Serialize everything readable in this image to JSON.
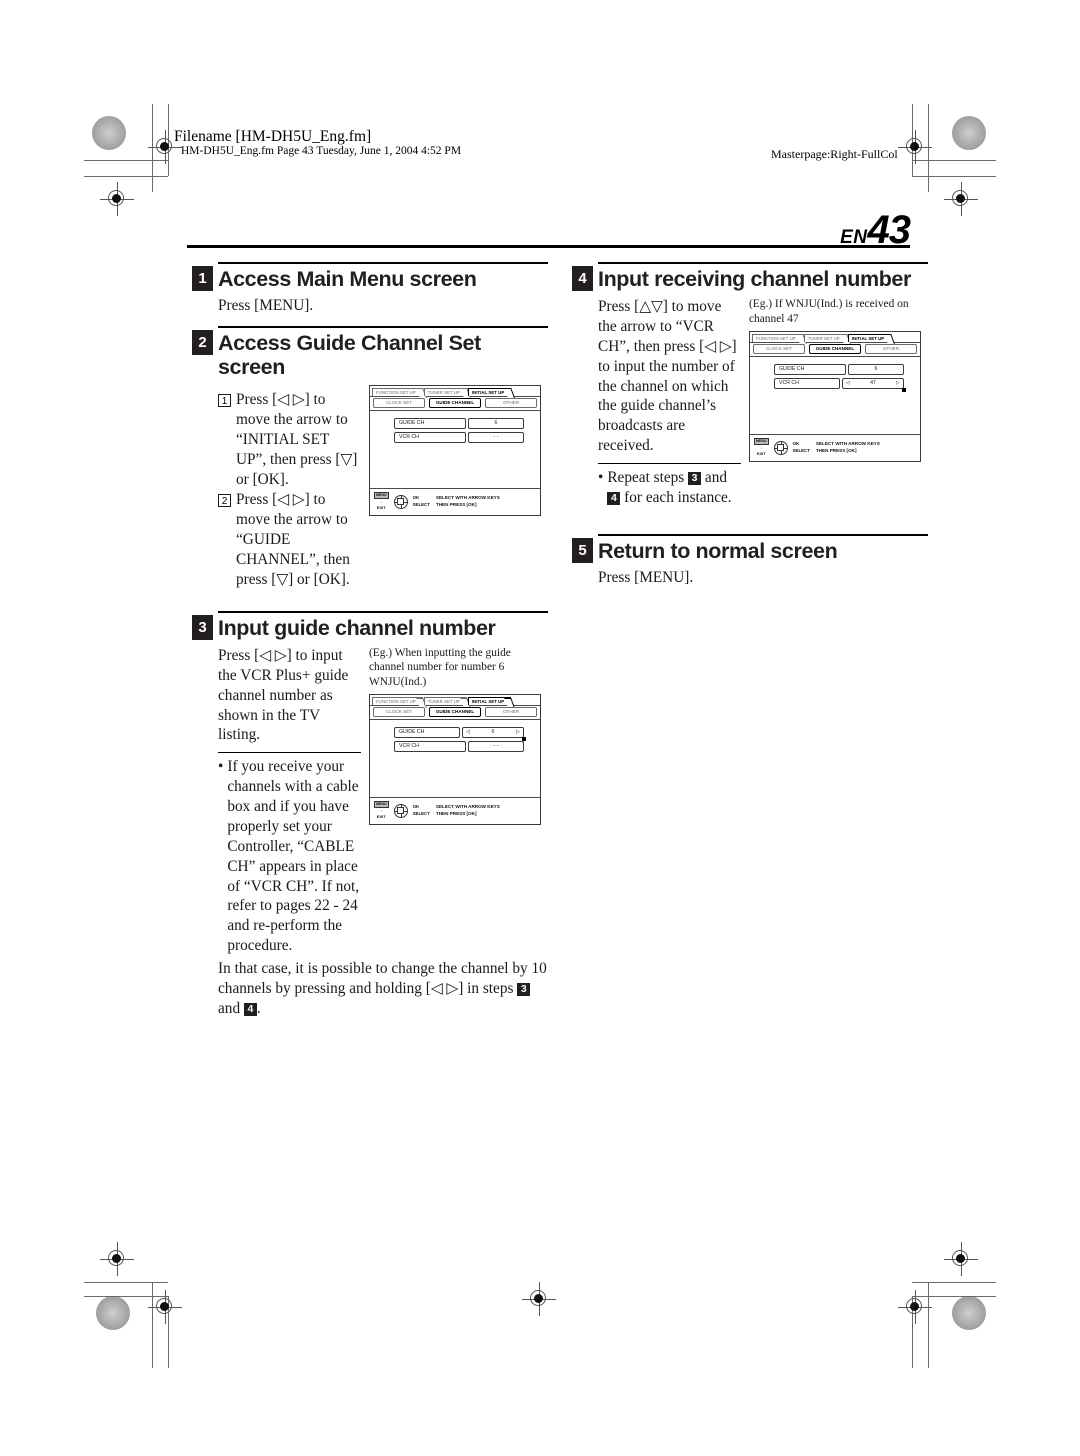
{
  "header": {
    "filename": "Filename [HM-DH5U_Eng.fm]",
    "fileinfo": "HM-DH5U_Eng.fm  Page 43  Tuesday, June 1, 2004  4:52 PM",
    "masterpage": "Masterpage:Right-FullCol"
  },
  "page": {
    "lang": "EN",
    "number": "43"
  },
  "steps": {
    "one": {
      "badge": "1",
      "title": "Access Main Menu screen",
      "press": "Press [MENU]."
    },
    "two": {
      "badge": "2",
      "title": "Access Guide Channel Set screen",
      "substeps": [
        {
          "badge": "1",
          "text": "Press [◁ ▷] to move the arrow to “INITIAL SET UP”, then press [▽] or [OK]."
        },
        {
          "badge": "2",
          "text": "Press [◁ ▷] to move the arrow to “GUIDE CHANNEL”, then press [▽] or [OK]."
        }
      ]
    },
    "three": {
      "badge": "3",
      "title": "Input guide channel number",
      "text": "Press [◁ ▷] to input the VCR Plus+ guide channel number as shown in the TV listing.",
      "caption": "(Eg.) When inputting the guide channel number for number 6 WNJU(Ind.)",
      "bullet": "If you receive your channels with a cable box and if you have properly set your Controller, “CABLE CH” appears in place of “VCR CH”. If not, refer to pages 22 - 24 and re-perform the procedure.",
      "note_pre": "In that case, it is possible to change the channel by 10 channels by pressing and holding [◁ ▷] in steps ",
      "note_badge_a": "3",
      "note_mid": " and ",
      "note_badge_b": "4",
      "note_post": "."
    },
    "four": {
      "badge": "4",
      "title": "Input receiving channel number",
      "text": "Press [△▽] to move the arrow to “VCR CH”, then press [◁ ▷] to input the number of the channel on which the guide channel’s broadcasts are received.",
      "caption": "(Eg.) If WNJU(Ind.) is received on channel 47",
      "repeat_pre": "Repeat steps ",
      "repeat_badge_a": "3",
      "repeat_mid": " and ",
      "repeat_badge_b": "4",
      "repeat_post": " for each instance."
    },
    "five": {
      "badge": "5",
      "title": "Return to normal screen",
      "press": "Press [MENU]."
    }
  },
  "osd": {
    "tabs": [
      "FUNCTION SET UP",
      "TUNER SET UP",
      "INITIAL SET UP"
    ],
    "active_tab": "INITIAL SET UP",
    "subtabs": [
      "CLOCK SET",
      "GUIDE CHANNEL",
      "OTHER"
    ],
    "legend": {
      "menu_chip": "MENU",
      "exit": "EXIT",
      "ok": "OK",
      "select": "SELECT",
      "instruction_line1": "SELECT WITH ARROW KEYS",
      "instruction_line2": "THEN PRESS [OK]"
    },
    "screen_step2": {
      "active_subtab": "GUIDE CHANNEL",
      "rows": [
        {
          "label": "GUIDE CH",
          "value": "6",
          "arrows": false
        },
        {
          "label": "VCR CH",
          "value": "- -",
          "arrows": false
        }
      ]
    },
    "screen_step3": {
      "active_subtab": "GUIDE CHANNEL",
      "rows": [
        {
          "label": "GUIDE CH",
          "value": "6",
          "arrows": true,
          "left": "◁",
          "right": "▷"
        },
        {
          "label": "VCR CH",
          "value": "- -",
          "arrows": false
        }
      ]
    },
    "screen_step4": {
      "active_subtab": "GUIDE CHANNEL",
      "rows": [
        {
          "label": "GUIDE CH",
          "value": "6",
          "arrows": false
        },
        {
          "label": "VCR CH",
          "value": "47",
          "arrows": true,
          "left": "◁",
          "right": "▷"
        }
      ]
    }
  }
}
